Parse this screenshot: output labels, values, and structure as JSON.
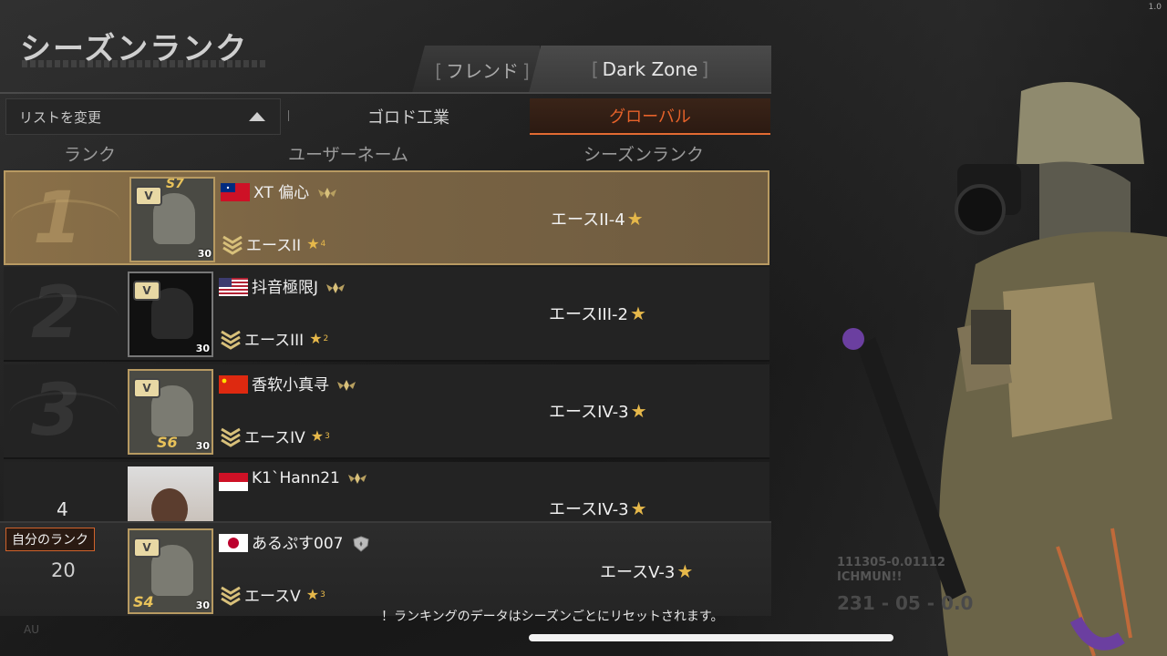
{
  "version": "1.0",
  "title": "シーズンランク",
  "tabs": {
    "friend": "フレンド",
    "darkzone": "Dark Zone"
  },
  "list_select": {
    "label": "リストを変更"
  },
  "subtabs": {
    "gorod": "ゴロド工業",
    "global": "グローバル"
  },
  "columns": {
    "rank": "ランク",
    "username": "ユーザーネーム",
    "season_rank": "シーズンランク"
  },
  "rows": [
    {
      "rank": "1",
      "username": "XT 偏心",
      "flag": "samoa",
      "sub_rank": "エースII",
      "sub_stars": "4",
      "season_rank": "エースII-4",
      "level": "30",
      "season_badge": "S7"
    },
    {
      "rank": "2",
      "username": "抖音極限J",
      "flag": "usa",
      "sub_rank": "エースIII",
      "sub_stars": "2",
      "season_rank": "エースIII-2",
      "level": "30",
      "season_badge": ""
    },
    {
      "rank": "3",
      "username": "香软小真寻",
      "flag": "china",
      "sub_rank": "エースIV",
      "sub_stars": "3",
      "season_rank": "エースIV-3",
      "level": "30",
      "season_badge": "S6"
    },
    {
      "rank": "4",
      "username": "K1`Hann21",
      "flag": "indonesia",
      "sub_rank": "",
      "sub_stars": "",
      "season_rank": "エースIV-3",
      "level": "",
      "season_badge": ""
    }
  ],
  "my_rank": {
    "label": "自分のランク",
    "rank": "20",
    "username": "あるぷす007",
    "flag": "japan",
    "sub_rank": "エースV",
    "sub_stars": "3",
    "season_rank": "エースV-3",
    "level": "30",
    "season_badge": "S4"
  },
  "notice": "！ランキングのデータはシーズンごとにリセットされます。",
  "stamp": {
    "line1": "111305-0.01112",
    "line2": "ICHMUN!!",
    "line3": "231 - 05 - 0.0"
  },
  "au_text": "AU",
  "dogtag_letter": "V",
  "star": "★",
  "colors": {
    "accent_orange": "#e26a32",
    "gold": "#e6b84a",
    "first_row": "#7a6444"
  }
}
